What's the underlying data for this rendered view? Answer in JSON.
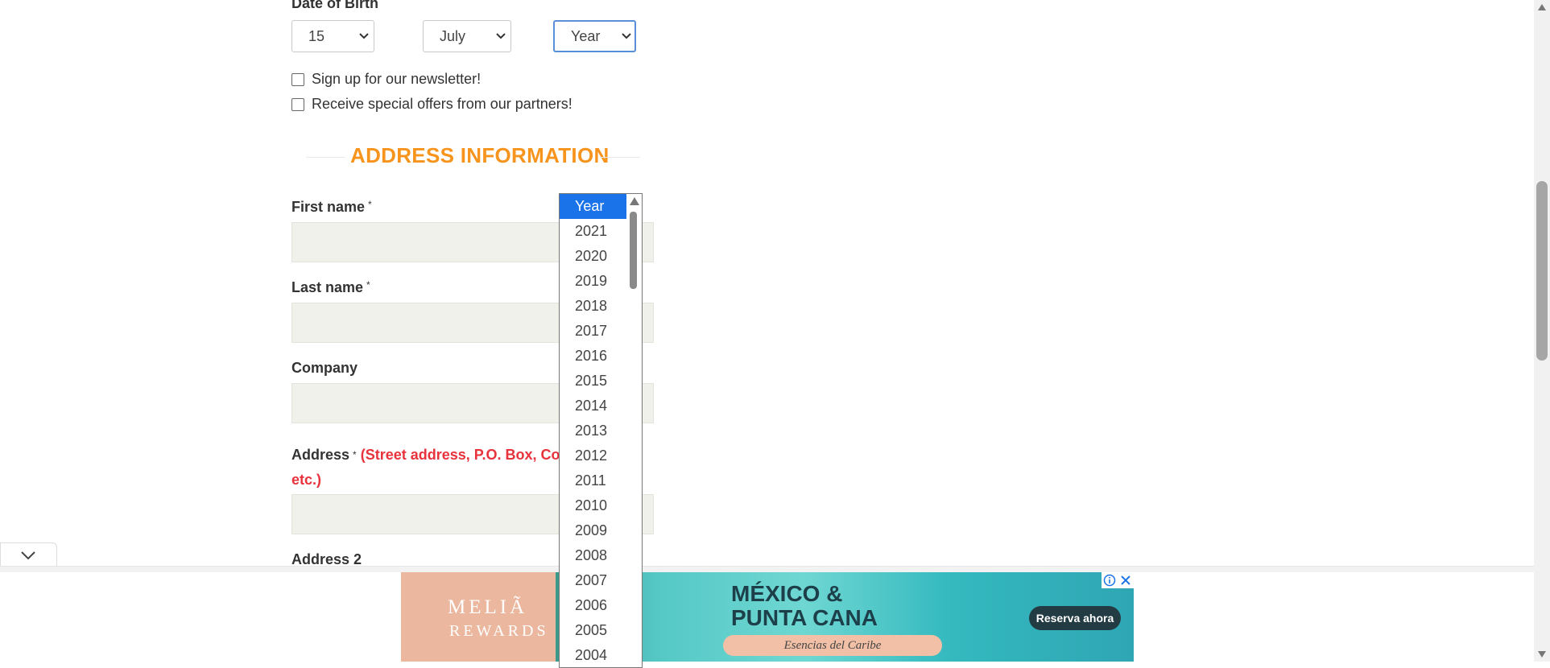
{
  "dob": {
    "label": "Date of Birth",
    "day": "15",
    "month": "July",
    "year": "Year"
  },
  "checkboxes": {
    "newsletter": "Sign up for our newsletter!",
    "offers": "Receive special offers from our partners!"
  },
  "section": {
    "title": "ADDRESS INFORMATION"
  },
  "fields": {
    "first_name": "First name",
    "last_name": "Last name",
    "company": "Company",
    "address": "Address",
    "address_note_1": "(Street address, P.O. Box, Com",
    "address_note_2": "etc.)",
    "address2": "Address 2",
    "required_mark": "*"
  },
  "year_dropdown": {
    "options": [
      "Year",
      "2021",
      "2020",
      "2019",
      "2018",
      "2017",
      "2016",
      "2015",
      "2014",
      "2013",
      "2012",
      "2011",
      "2010",
      "2009",
      "2008",
      "2007",
      "2006",
      "2005",
      "2004"
    ],
    "selected": "Year"
  },
  "ad": {
    "brand_line1": "MELIÃ",
    "brand_line2": "REWARDS",
    "headline_1": "MÉXICO &",
    "headline_2": "PUNTA CANA",
    "tagline": "Esencias del Caribe",
    "cta": "Reserva ahora"
  },
  "icons": {
    "chevron": "chevron-down-icon",
    "collapse": "chevron-down-icon",
    "ad_info": "info-icon",
    "ad_close": "close-icon"
  }
}
